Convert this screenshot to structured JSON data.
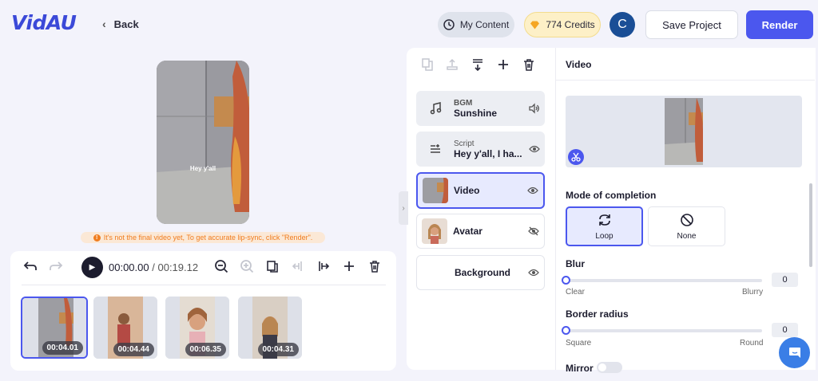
{
  "header": {
    "logo": "VidAU",
    "back_label": "Back",
    "my_content_label": "My Content",
    "credits_label": "774 Credits",
    "user_initial": "C",
    "save_label": "Save Project",
    "render_label": "Render"
  },
  "preview": {
    "caption": "Hey y'all",
    "warning": "It's not the final video yet, To get accurate lip-sync, click \"Render\"."
  },
  "timeline": {
    "current_time": "00:00.00",
    "separator": "/",
    "total_time": "00:19.12",
    "clips": [
      {
        "duration": "00:04.01",
        "selected": true
      },
      {
        "duration": "00:04.44",
        "selected": false
      },
      {
        "duration": "00:06.35",
        "selected": false
      },
      {
        "duration": "00:04.31",
        "selected": false
      }
    ]
  },
  "layers": [
    {
      "sub": "BGM",
      "label": "Sunshine",
      "icon": "music-note-icon",
      "action_icon": "volume-icon"
    },
    {
      "sub": "Script",
      "label": "Hey y'all, I ha...",
      "icon": "script-icon",
      "action_icon": "eye-icon"
    },
    {
      "sub": "",
      "label": "Video",
      "icon": "video-thumbnail",
      "action_icon": "eye-icon",
      "selected": true
    },
    {
      "sub": "",
      "label": "Avatar",
      "icon": "avatar-thumbnail",
      "action_icon": "eye-off-icon"
    },
    {
      "sub": "",
      "label": "Background",
      "icon": "",
      "action_icon": "eye-icon"
    }
  ],
  "properties": {
    "title": "Video",
    "mode_label": "Mode of completion",
    "mode_options": [
      {
        "label": "Loop",
        "selected": true
      },
      {
        "label": "None",
        "selected": false
      }
    ],
    "blur_label": "Blur",
    "blur_value": "0",
    "blur_min": "Clear",
    "blur_max": "Blurry",
    "radius_label": "Border radius",
    "radius_value": "0",
    "radius_min": "Square",
    "radius_max": "Round",
    "mirror_label": "Mirror"
  },
  "colors": {
    "accent": "#4b57ee",
    "warning": "#f07c1e",
    "avatar_bg": "#1a4e96"
  }
}
